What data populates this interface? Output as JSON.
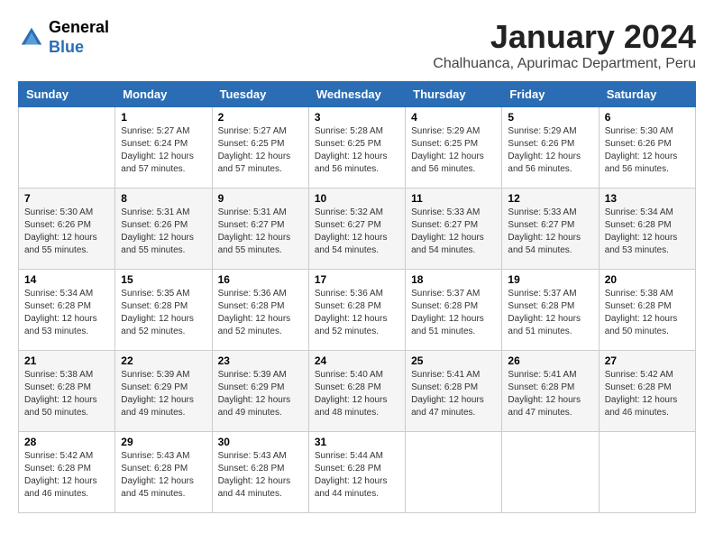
{
  "logo": {
    "line1": "General",
    "line2": "Blue"
  },
  "title": "January 2024",
  "location": "Chalhuanca, Apurimac Department, Peru",
  "weekdays": [
    "Sunday",
    "Monday",
    "Tuesday",
    "Wednesday",
    "Thursday",
    "Friday",
    "Saturday"
  ],
  "weeks": [
    [
      {
        "day": "",
        "sunrise": "",
        "sunset": "",
        "daylight": ""
      },
      {
        "day": "1",
        "sunrise": "Sunrise: 5:27 AM",
        "sunset": "Sunset: 6:24 PM",
        "daylight": "Daylight: 12 hours and 57 minutes."
      },
      {
        "day": "2",
        "sunrise": "Sunrise: 5:27 AM",
        "sunset": "Sunset: 6:25 PM",
        "daylight": "Daylight: 12 hours and 57 minutes."
      },
      {
        "day": "3",
        "sunrise": "Sunrise: 5:28 AM",
        "sunset": "Sunset: 6:25 PM",
        "daylight": "Daylight: 12 hours and 56 minutes."
      },
      {
        "day": "4",
        "sunrise": "Sunrise: 5:29 AM",
        "sunset": "Sunset: 6:25 PM",
        "daylight": "Daylight: 12 hours and 56 minutes."
      },
      {
        "day": "5",
        "sunrise": "Sunrise: 5:29 AM",
        "sunset": "Sunset: 6:26 PM",
        "daylight": "Daylight: 12 hours and 56 minutes."
      },
      {
        "day": "6",
        "sunrise": "Sunrise: 5:30 AM",
        "sunset": "Sunset: 6:26 PM",
        "daylight": "Daylight: 12 hours and 56 minutes."
      }
    ],
    [
      {
        "day": "7",
        "sunrise": "Sunrise: 5:30 AM",
        "sunset": "Sunset: 6:26 PM",
        "daylight": "Daylight: 12 hours and 55 minutes."
      },
      {
        "day": "8",
        "sunrise": "Sunrise: 5:31 AM",
        "sunset": "Sunset: 6:26 PM",
        "daylight": "Daylight: 12 hours and 55 minutes."
      },
      {
        "day": "9",
        "sunrise": "Sunrise: 5:31 AM",
        "sunset": "Sunset: 6:27 PM",
        "daylight": "Daylight: 12 hours and 55 minutes."
      },
      {
        "day": "10",
        "sunrise": "Sunrise: 5:32 AM",
        "sunset": "Sunset: 6:27 PM",
        "daylight": "Daylight: 12 hours and 54 minutes."
      },
      {
        "day": "11",
        "sunrise": "Sunrise: 5:33 AM",
        "sunset": "Sunset: 6:27 PM",
        "daylight": "Daylight: 12 hours and 54 minutes."
      },
      {
        "day": "12",
        "sunrise": "Sunrise: 5:33 AM",
        "sunset": "Sunset: 6:27 PM",
        "daylight": "Daylight: 12 hours and 54 minutes."
      },
      {
        "day": "13",
        "sunrise": "Sunrise: 5:34 AM",
        "sunset": "Sunset: 6:28 PM",
        "daylight": "Daylight: 12 hours and 53 minutes."
      }
    ],
    [
      {
        "day": "14",
        "sunrise": "Sunrise: 5:34 AM",
        "sunset": "Sunset: 6:28 PM",
        "daylight": "Daylight: 12 hours and 53 minutes."
      },
      {
        "day": "15",
        "sunrise": "Sunrise: 5:35 AM",
        "sunset": "Sunset: 6:28 PM",
        "daylight": "Daylight: 12 hours and 52 minutes."
      },
      {
        "day": "16",
        "sunrise": "Sunrise: 5:36 AM",
        "sunset": "Sunset: 6:28 PM",
        "daylight": "Daylight: 12 hours and 52 minutes."
      },
      {
        "day": "17",
        "sunrise": "Sunrise: 5:36 AM",
        "sunset": "Sunset: 6:28 PM",
        "daylight": "Daylight: 12 hours and 52 minutes."
      },
      {
        "day": "18",
        "sunrise": "Sunrise: 5:37 AM",
        "sunset": "Sunset: 6:28 PM",
        "daylight": "Daylight: 12 hours and 51 minutes."
      },
      {
        "day": "19",
        "sunrise": "Sunrise: 5:37 AM",
        "sunset": "Sunset: 6:28 PM",
        "daylight": "Daylight: 12 hours and 51 minutes."
      },
      {
        "day": "20",
        "sunrise": "Sunrise: 5:38 AM",
        "sunset": "Sunset: 6:28 PM",
        "daylight": "Daylight: 12 hours and 50 minutes."
      }
    ],
    [
      {
        "day": "21",
        "sunrise": "Sunrise: 5:38 AM",
        "sunset": "Sunset: 6:28 PM",
        "daylight": "Daylight: 12 hours and 50 minutes."
      },
      {
        "day": "22",
        "sunrise": "Sunrise: 5:39 AM",
        "sunset": "Sunset: 6:29 PM",
        "daylight": "Daylight: 12 hours and 49 minutes."
      },
      {
        "day": "23",
        "sunrise": "Sunrise: 5:39 AM",
        "sunset": "Sunset: 6:29 PM",
        "daylight": "Daylight: 12 hours and 49 minutes."
      },
      {
        "day": "24",
        "sunrise": "Sunrise: 5:40 AM",
        "sunset": "Sunset: 6:28 PM",
        "daylight": "Daylight: 12 hours and 48 minutes."
      },
      {
        "day": "25",
        "sunrise": "Sunrise: 5:41 AM",
        "sunset": "Sunset: 6:28 PM",
        "daylight": "Daylight: 12 hours and 47 minutes."
      },
      {
        "day": "26",
        "sunrise": "Sunrise: 5:41 AM",
        "sunset": "Sunset: 6:28 PM",
        "daylight": "Daylight: 12 hours and 47 minutes."
      },
      {
        "day": "27",
        "sunrise": "Sunrise: 5:42 AM",
        "sunset": "Sunset: 6:28 PM",
        "daylight": "Daylight: 12 hours and 46 minutes."
      }
    ],
    [
      {
        "day": "28",
        "sunrise": "Sunrise: 5:42 AM",
        "sunset": "Sunset: 6:28 PM",
        "daylight": "Daylight: 12 hours and 46 minutes."
      },
      {
        "day": "29",
        "sunrise": "Sunrise: 5:43 AM",
        "sunset": "Sunset: 6:28 PM",
        "daylight": "Daylight: 12 hours and 45 minutes."
      },
      {
        "day": "30",
        "sunrise": "Sunrise: 5:43 AM",
        "sunset": "Sunset: 6:28 PM",
        "daylight": "Daylight: 12 hours and 44 minutes."
      },
      {
        "day": "31",
        "sunrise": "Sunrise: 5:44 AM",
        "sunset": "Sunset: 6:28 PM",
        "daylight": "Daylight: 12 hours and 44 minutes."
      },
      {
        "day": "",
        "sunrise": "",
        "sunset": "",
        "daylight": ""
      },
      {
        "day": "",
        "sunrise": "",
        "sunset": "",
        "daylight": ""
      },
      {
        "day": "",
        "sunrise": "",
        "sunset": "",
        "daylight": ""
      }
    ]
  ]
}
